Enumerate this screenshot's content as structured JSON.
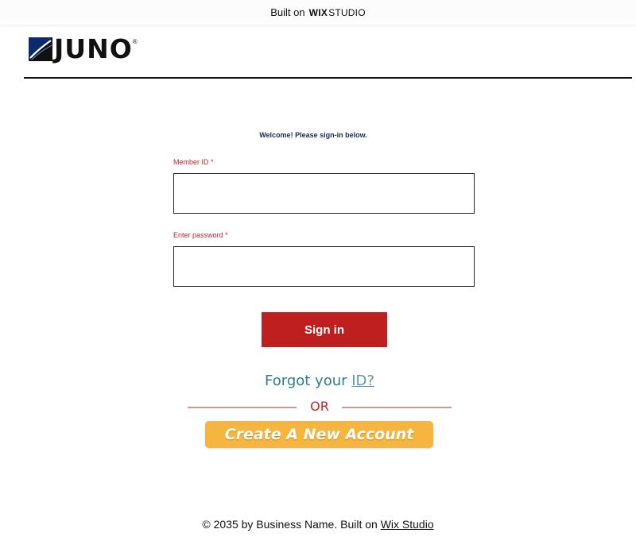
{
  "wix_banner": {
    "prefix": "Built on",
    "wix": "WIX",
    "studio": "STUDIO"
  },
  "header": {
    "logo_text": "JUNO",
    "logo_mark": "®"
  },
  "form": {
    "welcome": "Welcome! Please sign-in below.",
    "member_id": {
      "label": "Member ID",
      "required": "*",
      "value": ""
    },
    "password": {
      "label": "Enter password",
      "required": "*",
      "value": ""
    },
    "signin_label": "Sign in",
    "forgot_prefix": "Forgot your",
    "forgot_link": "ID?",
    "or_text": "OR",
    "create_account_label": "Create A New Account"
  },
  "footer": {
    "text": "© 2035 by Business Name. Built on",
    "link": "Wix Studio"
  },
  "colors": {
    "accent_red": "#c01f1f",
    "label_red": "#c0282d",
    "welcome_navy": "#1a2a5c",
    "forgot_teal": "#2a7d93",
    "create_orange": "#f5b53e"
  }
}
